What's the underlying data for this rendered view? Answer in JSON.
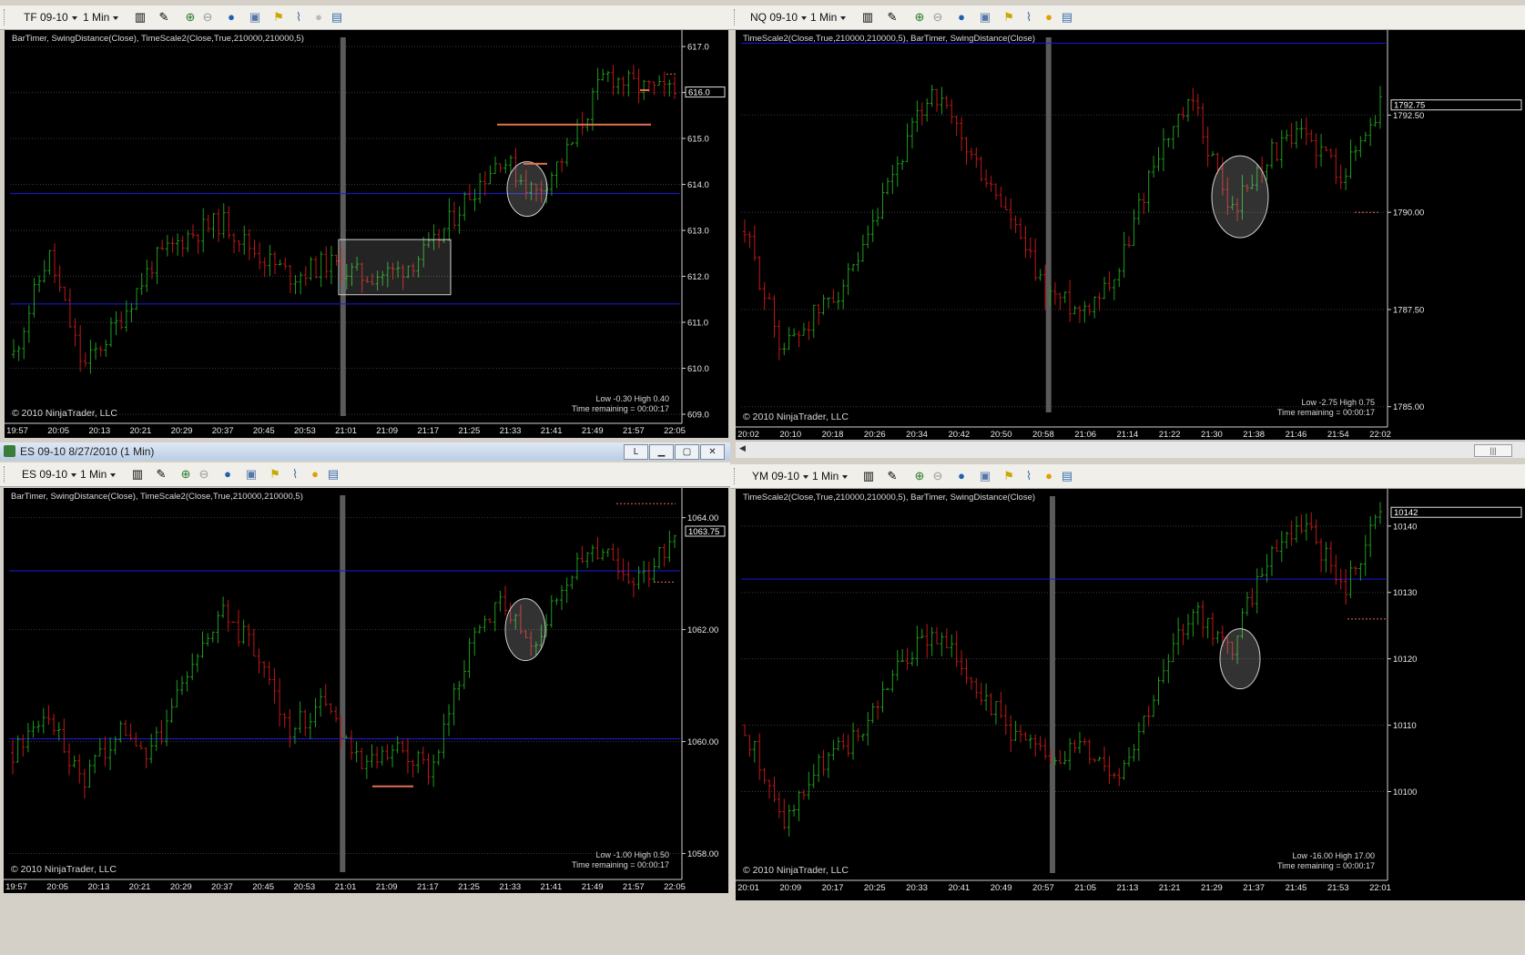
{
  "panels": [
    {
      "id": "tf",
      "instrument": "TF 09-10",
      "interval": "1 Min",
      "indicators": "BarTimer,  SwingDistance(Close),  TimeScale2(Close,True,210000,210000,5)",
      "copyright": "© 2010 NinjaTrader, LLC",
      "low_high": "Low -0.30   High 0.40",
      "time_remaining": "Time remaining = 00:00:17",
      "y_ticks": [
        "617.0",
        "616.0",
        "615.0",
        "614.0",
        "613.0",
        "612.0",
        "611.0",
        "610.0",
        "609.0"
      ],
      "y_tick_values": [
        617,
        616,
        615,
        614,
        613,
        612,
        611,
        610,
        609
      ],
      "y_range": [
        609,
        617.2
      ],
      "price_marker": "616.0",
      "price_marker_value": 616.0,
      "x_ticks": [
        "19:57",
        "20:05",
        "20:13",
        "20:21",
        "20:29",
        "20:37",
        "20:45",
        "20:53",
        "21:01",
        "21:09",
        "21:17",
        "21:25",
        "21:33",
        "21:41",
        "21:49",
        "21:57",
        "22:05"
      ],
      "session_marker_label": "21:01",
      "hlines": [
        613.8,
        611.4
      ],
      "annotations": [
        "rectangle 21:01-21:17",
        "ellipse 21:33-21:37"
      ],
      "seed": 11,
      "bars": 130,
      "path": [
        610.3,
        612.5,
        610.0,
        611.0,
        612.3,
        612.9,
        613.2,
        612.5,
        612.0,
        612.3,
        612.0,
        612.1,
        612.6,
        613.7,
        614.6,
        613.8,
        614.8,
        616.4,
        616.1,
        616.0
      ]
    },
    {
      "id": "nq",
      "instrument": "NQ 09-10",
      "interval": "1 Min",
      "indicators": "TimeScale2(Close,True,210000,210000,5),  BarTimer,  SwingDistance(Close)",
      "copyright": "© 2010 NinjaTrader, LLC",
      "low_high": "Low -2.75   High 0.75",
      "time_remaining": "Time remaining = 00:00:17",
      "y_ticks": [
        "1792.50",
        "1790.00",
        "1787.50",
        "1785.00"
      ],
      "y_tick_values": [
        1792.5,
        1790.0,
        1787.5,
        1785.0
      ],
      "y_range": [
        1784.9,
        1794.5
      ],
      "price_marker": "1792.75",
      "price_marker_value": 1792.75,
      "x_ticks": [
        "20:02",
        "20:10",
        "20:18",
        "20:26",
        "20:34",
        "20:42",
        "20:50",
        "20:58",
        "21:06",
        "21:14",
        "21:22",
        "21:30",
        "21:38",
        "21:46",
        "21:54",
        "22:02"
      ],
      "session_marker_label": "20:58",
      "hlines": [
        1794.35
      ],
      "annotations": [
        "ellipse 21:34-21:40"
      ],
      "seed": 29,
      "bars": 130,
      "path": [
        1789.5,
        1786.5,
        1787.5,
        1788.5,
        1791.0,
        1793.2,
        1791.5,
        1790.0,
        1788.0,
        1787.5,
        1788.5,
        1791.5,
        1792.8,
        1790.0,
        1791.5,
        1792.0,
        1791.0,
        1792.75
      ]
    },
    {
      "id": "es",
      "instrument": "ES 09-10",
      "interval": "1 Min",
      "window_title": "ES 09-10  8/27/2010 (1 Min)",
      "indicators": "BarTimer,  SwingDistance(Close),  TimeScale2(Close,True,210000,210000,5)",
      "copyright": "© 2010 NinjaTrader, LLC",
      "low_high": "Low -1.00   High 0.50",
      "time_remaining": "Time remaining = 00:00:17",
      "y_ticks": [
        "1064.00",
        "1062.00",
        "1060.00",
        "1058.00"
      ],
      "y_tick_values": [
        1064,
        1062,
        1060,
        1058
      ],
      "y_range": [
        1057.7,
        1064.4
      ],
      "price_marker": "1063.75",
      "price_marker_value": 1063.75,
      "x_ticks": [
        "19:57",
        "20:05",
        "20:13",
        "20:21",
        "20:29",
        "20:37",
        "20:45",
        "20:53",
        "21:01",
        "21:09",
        "21:17",
        "21:25",
        "21:33",
        "21:41",
        "21:49",
        "21:57",
        "22:05"
      ],
      "session_marker_label": "21:01",
      "hlines": [
        1063.05,
        1060.05
      ],
      "annotations": [
        "ellipse 21:33-21:37",
        "line 21:07-21:13"
      ],
      "seed": 47,
      "bars": 130,
      "path": [
        1059.8,
        1060.5,
        1059.2,
        1060.2,
        1059.8,
        1061.2,
        1062.3,
        1061.6,
        1060.2,
        1060.8,
        1059.5,
        1059.8,
        1059.5,
        1061.5,
        1062.6,
        1061.8,
        1063.0,
        1063.5,
        1062.8,
        1063.75
      ]
    },
    {
      "id": "ym",
      "instrument": "YM 09-10",
      "interval": "1 Min",
      "indicators": "TimeScale2(Close,True,210000,210000,5),  BarTimer,  SwingDistance(Close)",
      "copyright": "© 2010 NinjaTrader, LLC",
      "low_high": "Low -16.00   High 17.00",
      "time_remaining": "Time remaining = 00:00:17",
      "y_ticks": [
        "10140",
        "10130",
        "10120",
        "10110",
        "10100"
      ],
      "y_tick_values": [
        10140,
        10130,
        10120,
        10110,
        10100
      ],
      "y_range": [
        10088,
        10144.5
      ],
      "price_marker": "10142",
      "price_marker_value": 10142,
      "x_ticks": [
        "20:01",
        "20:09",
        "20:17",
        "20:25",
        "20:33",
        "20:41",
        "20:49",
        "20:57",
        "21:05",
        "21:13",
        "21:21",
        "21:29",
        "21:37",
        "21:45",
        "21:53",
        "22:01"
      ],
      "session_marker_label": "20:57",
      "hlines": [
        10132
      ],
      "annotations": [
        "ellipse 21:35-21:41"
      ],
      "seed": 71,
      "bars": 130,
      "path": [
        10110,
        10095,
        10104,
        10108,
        10118,
        10124,
        10118,
        10110,
        10105,
        10107,
        10103,
        10115,
        10128,
        10121,
        10136,
        10141,
        10130,
        10142
      ]
    }
  ],
  "colors": {
    "background": "#000000",
    "up_bar": "#1e9e1e",
    "down_bar": "#c01818",
    "hline": "#1a1ae0",
    "grid": "#3a3a3a",
    "session_marker": "#5a5a5a",
    "annotation_line": "#e07050",
    "axis_text": "#e8e8e8",
    "overlay_text": "#d8d8d8"
  },
  "toolbar_icons": [
    "bar-style-icon",
    "draw-tool-icon",
    "zoom-in-icon",
    "zoom-out-icon",
    "globe-icon",
    "properties-icon",
    "strategy-icon",
    "indicator-icon",
    "dollar-icon",
    "data-box-icon"
  ]
}
